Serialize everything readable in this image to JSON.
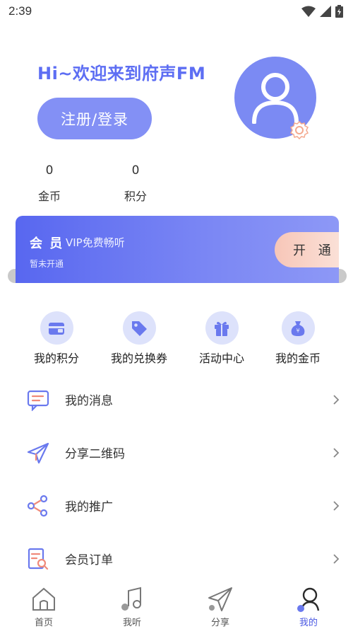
{
  "status_bar": {
    "time": "2:39"
  },
  "header": {
    "greeting": "Hi~欢迎来到府声FM",
    "login_button": "注册/登录"
  },
  "stats": [
    {
      "value": "0",
      "label": "金币"
    },
    {
      "value": "0",
      "label": "积分"
    }
  ],
  "vip": {
    "title": "会 员",
    "subtitle": "VIP免费畅听",
    "status": "暂未开通",
    "open_button": "开 通"
  },
  "quick_actions": [
    {
      "label": "我的积分",
      "icon": "points-icon"
    },
    {
      "label": "我的兑换券",
      "icon": "coupon-icon"
    },
    {
      "label": "活动中心",
      "icon": "gift-icon"
    },
    {
      "label": "我的金币",
      "icon": "coin-bag-icon"
    }
  ],
  "menu": [
    {
      "label": "我的消息",
      "icon": "message-icon"
    },
    {
      "label": "分享二维码",
      "icon": "send-icon"
    },
    {
      "label": "我的推广",
      "icon": "share-icon"
    },
    {
      "label": "会员订单",
      "icon": "order-icon"
    }
  ],
  "tabs": [
    {
      "label": "首页",
      "icon": "home-icon"
    },
    {
      "label": "我听",
      "icon": "music-icon"
    },
    {
      "label": "分享",
      "icon": "paper-plane-icon"
    },
    {
      "label": "我的",
      "icon": "profile-icon",
      "active": true
    }
  ],
  "colors": {
    "accent": "#5d6ef3",
    "avatar_bg": "#7b8af3",
    "login_bg": "#8390f5",
    "icon_bg": "#dde2fb"
  }
}
